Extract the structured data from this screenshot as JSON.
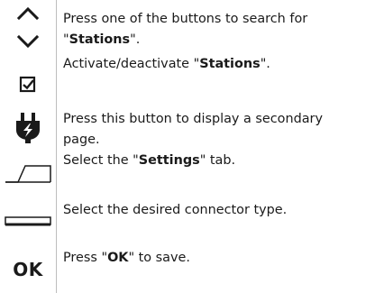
{
  "icons": {
    "row1a": "chevron-up-icon",
    "row1b": "chevron-down-icon",
    "row2": "checkbox-icon",
    "row3": "plug-icon",
    "row4": "settings-tab-icon",
    "row5": "connector-type-icon",
    "row6_label": "OK"
  },
  "rows": [
    {
      "line1_pre": "Press one of the buttons to search for",
      "line2_q1": "\"",
      "line2_bold": "Stations",
      "line2_post": "\"."
    },
    {
      "pre": "Activate/deactivate \"",
      "bold": "Stations",
      "post": "\"."
    },
    {
      "line1": "Press this button to display a secondary",
      "line2": "page."
    },
    {
      "pre": "Select the \"",
      "bold": "Settings",
      "post": "\" tab."
    },
    {
      "text": "Select the desired connector type."
    },
    {
      "pre": "Press \"",
      "bold": "OK",
      "post": "\" to save."
    }
  ]
}
